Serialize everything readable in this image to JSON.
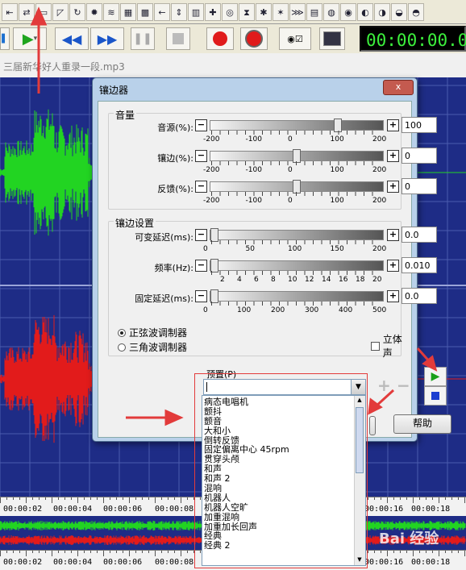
{
  "toolbar": {
    "icons": [
      "cursor-icon",
      "zoom-fit-icon",
      "flanger-icon",
      "ruler-icon",
      "loop-icon",
      "gear-icon",
      "eq-icon",
      "table-icon",
      "grid-icon",
      "left-arrow-icon",
      "vertical-arrows-icon",
      "bars-icon",
      "plus-green-icon",
      "eye-icon",
      "hourglass-icon",
      "star-icon",
      "antenna-icon",
      "wave-icon",
      "palette-icon",
      "cd-icon",
      "disc-icon",
      "disc-a-icon",
      "disc-b-icon",
      "disc-c-icon",
      "disc-d-icon"
    ]
  },
  "transport": {
    "timer": "00:00:00.0"
  },
  "file": {
    "name": "三届新华好人重录一段.mp3"
  },
  "rulers": {
    "top": [
      "00:00:02",
      "00:00:04",
      "00:00:06",
      "00:00:08",
      "00:00:16",
      "00:00:18"
    ],
    "bottom": [
      "00:00:02",
      "00:00:04",
      "00:00:06",
      "00:00:08",
      "00:00:16",
      "00:00:18"
    ]
  },
  "dialog": {
    "title": "镶边器",
    "volume_group": "音量",
    "modulation_group": "镶边设置",
    "sliders": [
      {
        "label": "音源(%):",
        "value": "100",
        "scale": [
          "-200",
          "-100",
          "0",
          "100",
          "200"
        ],
        "min": -200,
        "max": 200,
        "pos": 100
      },
      {
        "label": "镶边(%):",
        "value": "0",
        "scale": [
          "-200",
          "-100",
          "0",
          "100",
          "200"
        ],
        "min": -200,
        "max": 200,
        "pos": 0
      },
      {
        "label": "反馈(%):",
        "value": "0",
        "scale": [
          "-200",
          "-100",
          "0",
          "100",
          "200"
        ],
        "min": -200,
        "max": 200,
        "pos": 0
      },
      {
        "label": "可变延迟(ms):",
        "value": "0.0",
        "scale": [
          "0",
          "50",
          "100",
          "150",
          "200"
        ],
        "min": 0,
        "max": 200,
        "pos": 0
      },
      {
        "label": "频率(Hz):",
        "value": "0.010",
        "scale": [
          "2",
          "4",
          "6",
          "8",
          "10",
          "12",
          "14",
          "16",
          "18",
          "20"
        ],
        "min": 0,
        "max": 20,
        "pos": 0
      },
      {
        "label": "固定延迟(ms):",
        "value": "0.0",
        "scale": [
          "0",
          "100",
          "200",
          "300",
          "400",
          "500"
        ],
        "min": 0,
        "max": 500,
        "pos": 0
      }
    ],
    "radio_sine": "正弦波调制器",
    "radio_triangle": "三角波调制器",
    "stereo": "立体声",
    "preset_label": "预置(P)",
    "help": "帮助",
    "close": "x"
  },
  "presets": [
    "病态电唱机",
    "颤抖",
    "颤音",
    "大和小",
    "倒转反馈",
    "固定偏离中心 45rpm",
    "贯穿头颅",
    "和声",
    "和声 2",
    "混响",
    "机器人",
    "机器人空旷",
    "加重混响",
    "加重加长回声",
    "经典",
    "经典 2"
  ],
  "colors": {
    "wave_bg": "#1e2c86",
    "wave_green": "#22d422",
    "wave_red": "#e21b1b",
    "annotation": "#e23b3b"
  },
  "watermark": "Bai 经验"
}
